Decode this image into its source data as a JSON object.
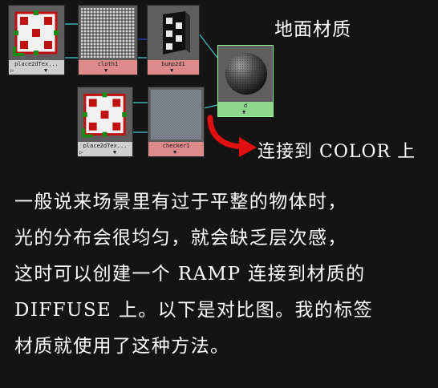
{
  "nodes": {
    "place2d_top": {
      "label": "place2dTex...",
      "port_left": "▷",
      "port_right": "▼"
    },
    "cloth": {
      "label": "cloth1",
      "port_mid": "▼"
    },
    "bump": {
      "label": "bump2d1",
      "port_mid": "▼"
    },
    "material": {
      "label": "d",
      "port_mid": "▼"
    },
    "place2d_bottom": {
      "label": "place2dTex...",
      "port_left": "▷",
      "port_right": "▼"
    },
    "checker": {
      "label": "checker1",
      "port_mid": "▼"
    }
  },
  "captions": {
    "title": "地面材质",
    "connect": "连接到 COLOR 上"
  },
  "paragraph": [
    "一般说来场景里有过于平整的物体时，",
    "光的分布会很均匀，就会缺乏层次感，",
    "这时可以创建一个 RAMP 连接到材质的",
    "DIFFUSE 上。以下是对比图。我的标签",
    "材质就使用了这种方法。"
  ],
  "colors": {
    "background": "#141414",
    "texture_label": "#dd8a8a",
    "material_label": "#8ed68e",
    "wire_cyan": "#3fc9c9",
    "wire_blue": "#2e3fd0",
    "arrow_red": "#e01010"
  },
  "icons": {
    "arrow": "red-curved-arrow-icon",
    "place2d": "place2d-texture-icon",
    "bump": "bump2d-icon",
    "cloth": "cloth-texture-icon",
    "checker": "checker-texture-icon",
    "material": "shader-sphere-icon"
  }
}
